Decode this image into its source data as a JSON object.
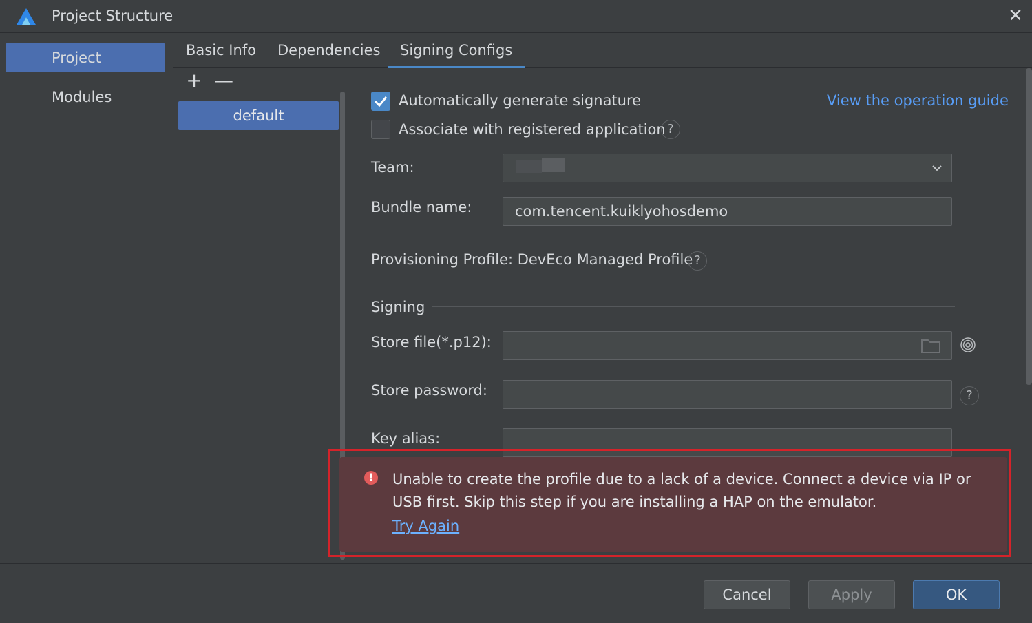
{
  "window": {
    "title": "Project Structure",
    "close_glyph": "✕"
  },
  "nav": {
    "items": [
      "Project",
      "Modules"
    ],
    "selected": "Project"
  },
  "tabs": {
    "items": [
      "Basic Info",
      "Dependencies",
      "Signing Configs"
    ],
    "active": "Signing Configs"
  },
  "config_list": {
    "add": "+",
    "remove": "—",
    "items": [
      "default"
    ]
  },
  "signing": {
    "auto_generate": {
      "label": "Automatically generate signature",
      "checked": true
    },
    "associate": {
      "label": "Associate with registered application",
      "checked": false
    },
    "guide_link": "View the operation guide",
    "team": {
      "label": "Team:",
      "value": ""
    },
    "bundle": {
      "label": "Bundle name:",
      "value": "com.tencent.kuiklyohosdemo"
    },
    "profile": {
      "label": "Provisioning Profile: DevEco Managed Profile"
    },
    "section_title": "Signing",
    "store_file": {
      "label": "Store file(*.p12):",
      "value": ""
    },
    "store_password": {
      "label": "Store password:",
      "value": ""
    },
    "key_alias": {
      "label": "Key alias:",
      "value": ""
    }
  },
  "error": {
    "message": "Unable to create the profile due to a lack of a device. Connect a device via IP or USB first. Skip this step if you are installing a HAP on the emulator.",
    "action": "Try Again"
  },
  "footer": {
    "cancel": "Cancel",
    "apply": "Apply",
    "ok": "OK"
  },
  "colors": {
    "accent": "#4b6eaf",
    "link": "#589df6",
    "error_bg": "#5c3a3e",
    "highlight": "#d4232a"
  },
  "icons": [
    "app-logo-icon",
    "close-icon",
    "checkmark-icon",
    "help-icon",
    "chevron-down-icon",
    "folder-icon",
    "fingerprint-icon",
    "error-icon"
  ]
}
